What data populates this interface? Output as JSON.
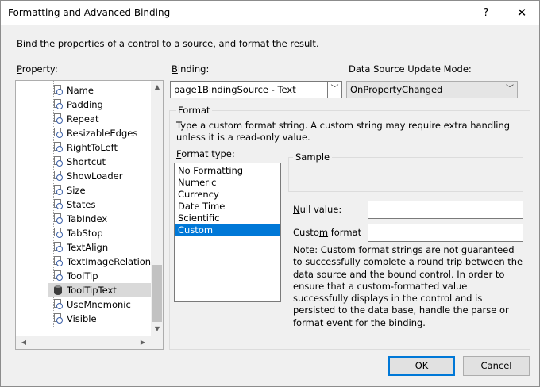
{
  "window": {
    "title": "Formatting and Advanced Binding",
    "help_label": "?",
    "close_label": "✕"
  },
  "description": "Bind the properties of a control to a source, and format the result.",
  "labels": {
    "property": "Property:",
    "binding": "Binding:",
    "update_mode": "Data Source Update Mode:"
  },
  "property_tree": {
    "items": [
      {
        "label": "Name",
        "icon": "property-icon"
      },
      {
        "label": "Padding",
        "icon": "property-icon"
      },
      {
        "label": "Repeat",
        "icon": "property-icon"
      },
      {
        "label": "ResizableEdges",
        "icon": "property-icon"
      },
      {
        "label": "RightToLeft",
        "icon": "property-icon"
      },
      {
        "label": "Shortcut",
        "icon": "property-icon"
      },
      {
        "label": "ShowLoader",
        "icon": "property-icon"
      },
      {
        "label": "Size",
        "icon": "property-icon"
      },
      {
        "label": "States",
        "icon": "property-icon"
      },
      {
        "label": "TabIndex",
        "icon": "property-icon"
      },
      {
        "label": "TabStop",
        "icon": "property-icon"
      },
      {
        "label": "TextAlign",
        "icon": "property-icon"
      },
      {
        "label": "TextImageRelation",
        "icon": "property-icon"
      },
      {
        "label": "ToolTip",
        "icon": "property-icon"
      },
      {
        "label": "ToolTipText",
        "icon": "database-icon"
      },
      {
        "label": "UseMnemonic",
        "icon": "property-icon"
      },
      {
        "label": "Visible",
        "icon": "property-icon"
      }
    ],
    "selected_index": 14
  },
  "binding": {
    "value": "page1BindingSource - Text"
  },
  "update_mode": {
    "value": "OnPropertyChanged"
  },
  "format": {
    "group_label": "Format",
    "description": "Type a custom format string. A custom string may require extra handling unless it is a read-only value.",
    "type_label": "Format type:",
    "types": [
      "No Formatting",
      "Numeric",
      "Currency",
      "Date Time",
      "Scientific",
      "Custom"
    ],
    "selected_type_index": 5,
    "sample_label": "Sample",
    "null_value_label": "Null value:",
    "custom_format_label": "Custom format",
    "null_value": "",
    "custom_format": "",
    "note": "Note: Custom format strings are not guaranteed  to successfully complete a round trip between the data source and the bound control. In order to ensure that a custom-formatted value successfully displays in the control and is persisted to the data base, handle the parse or format event for the binding."
  },
  "buttons": {
    "ok": "OK",
    "cancel": "Cancel"
  },
  "colors": {
    "selection": "#0078d7",
    "default_button_border": "#0078d7"
  }
}
